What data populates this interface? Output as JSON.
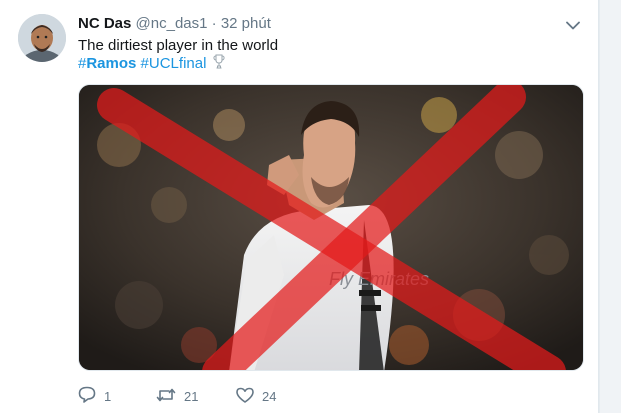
{
  "tweet": {
    "display_name": "NC Das",
    "handle": "@nc_das1",
    "separator": "·",
    "time": "32 phút",
    "text": "The dirtiest player in the world",
    "hashtags": [
      "#Ramos",
      "#UCLfinal"
    ],
    "jersey_text": "Fly Emirates",
    "counts": {
      "reply": "1",
      "retweet": "21",
      "like": "24"
    }
  },
  "colors": {
    "link": "#1b95e0",
    "muted": "#657786",
    "cross": "#e31b1b"
  },
  "icons": {
    "caret": "chevron-down-icon",
    "reply": "reply-icon",
    "retweet": "retweet-icon",
    "like": "heart-icon",
    "trophy": "trophy-icon"
  }
}
